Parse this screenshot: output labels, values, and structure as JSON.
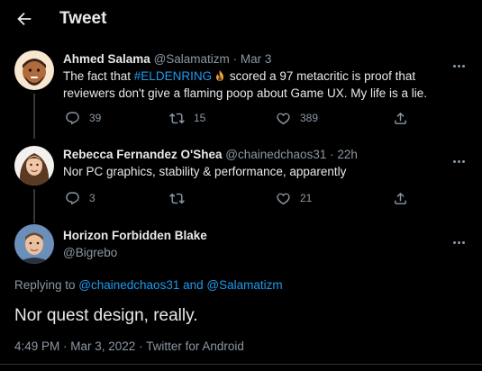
{
  "header": {
    "title": "Tweet"
  },
  "tweets": [
    {
      "name": "Ahmed Salama",
      "handle": "@Salamatizm",
      "sep": "·",
      "time": "Mar 3",
      "text_before": "The fact that ",
      "hashtag": "#ELDENRING",
      "text_after": " scored a 97 metacritic is proof that reviewers don't give a flaming poop about Game UX. My life is a lie.",
      "replies": "39",
      "retweets": "15",
      "likes": "389"
    },
    {
      "name": "Rebecca Fernandez O'Shea",
      "handle": "@chainedchaos31",
      "sep": "·",
      "time": "22h",
      "text": "Nor PC graphics, stability & performance, apparently",
      "replies": "3",
      "retweets": "",
      "likes": "21"
    }
  ],
  "main_tweet": {
    "name": "Horizon Forbidden Blake",
    "handle": "@Bigrebo",
    "replying_prefix": "Replying to ",
    "mention1": "@chainedchaos31",
    "and": " and ",
    "mention2": "@Salamatizm",
    "text": "Nor quest design, really.",
    "meta": "4:49 PM · Mar 3, 2022 · Twitter for Android"
  },
  "colors": {
    "accent": "#1d9bf0",
    "background": "#000000",
    "secondary": "#8b98a5"
  },
  "icons": [
    "back-arrow-icon",
    "reply-icon",
    "retweet-icon",
    "like-icon",
    "share-icon",
    "more-icon",
    "fire-emoji-icon"
  ]
}
